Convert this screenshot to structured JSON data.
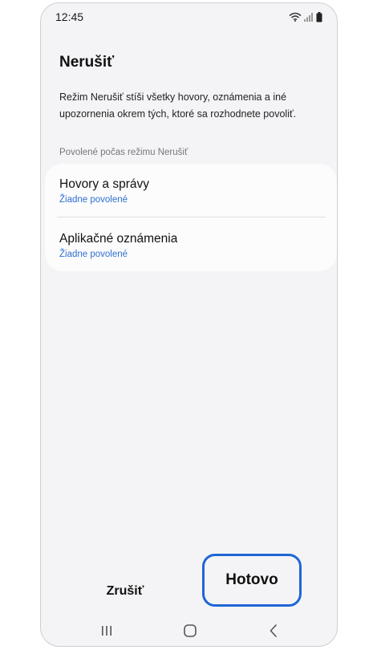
{
  "status_bar": {
    "time": "12:45",
    "icons": [
      "wifi-icon",
      "signal-icon",
      "battery-icon"
    ]
  },
  "page": {
    "title": "Nerušiť",
    "description": "Režim Nerušiť stíši všetky hovory, oznámenia a iné upozornenia okrem tých, ktoré sa rozhodnete povoliť."
  },
  "allowed_section": {
    "header": "Povolené počas režimu Nerušiť",
    "items": [
      {
        "title": "Hovory a správy",
        "subtitle": "Žiadne povolené"
      },
      {
        "title": "Aplikačné oznámenia",
        "subtitle": "Žiadne povolené"
      }
    ]
  },
  "actions": {
    "cancel_label": "Zrušiť",
    "done_label": "Hotovo"
  },
  "colors": {
    "accent": "#2f6fd0",
    "highlight": "#1e66d6",
    "background": "#f4f4f6",
    "card": "#fcfcfd"
  },
  "nav_bar": {
    "icons": [
      "recents-icon",
      "home-icon",
      "back-icon"
    ]
  }
}
